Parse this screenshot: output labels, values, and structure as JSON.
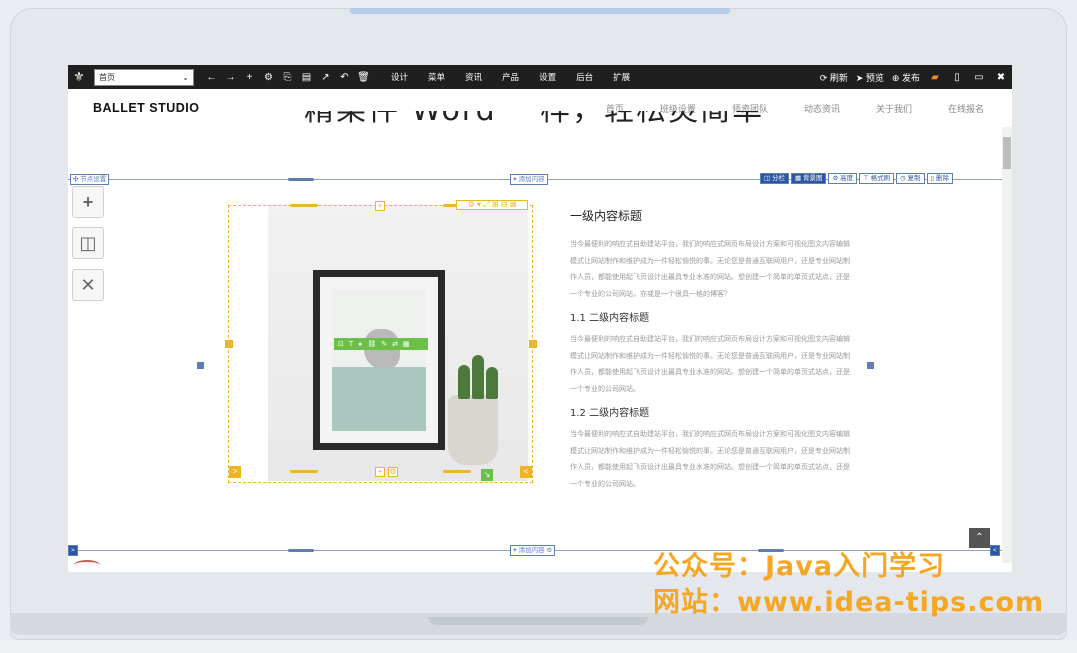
{
  "toolbar": {
    "page_select_value": "首页",
    "menus": [
      "设计",
      "菜单",
      "资讯",
      "产品",
      "设置",
      "后台",
      "扩展"
    ],
    "actions": {
      "refresh": "刷新",
      "preview": "预览",
      "publish": "发布"
    }
  },
  "site": {
    "brand": "BALLET STUDIO",
    "nav": [
      "首页",
      "班级设置",
      "师资团队",
      "动态资讯",
      "关于我们",
      "在线报名"
    ],
    "cut_heading": "精某件 Word 一样，轻松灵简单"
  },
  "guides": {
    "section_settings": "节点设置",
    "add_content_top": "添加内容",
    "add_content_bottom": "添加内容",
    "toolstrip": [
      "分栏",
      "背景图",
      "高度",
      "格式刷",
      "复制",
      "删除"
    ]
  },
  "content": {
    "h1": "一级内容标题",
    "p1": "当今最便利的响应式自助建站平台，我们的响应式网页布局设计方案和可视化图文内容编辑模式让网站制作和维护成为一件轻松愉悦的事。无论您是普通互联网用户，还是专业网站制作人员，都能使用起飞页设计出最具专业水准的网站。想创建一个简单的单页式站点，还是一个专业的公司网站，亦或是一个很具一格的博客？",
    "h2a": "1.1 二级内容标题",
    "p2": "当今最便利的响应式自助建站平台，我们的响应式网页布局设计方案和可视化图文内容编辑模式让网站制作和维护成为一件轻松愉悦的事。无论您是普通互联网用户，还是专业网站制作人员，都能使用起飞页设计出最具专业水准的网站。想创建一个简单的单页式站点，还是一个专业的公司网站。",
    "h2b": "1.2 二级内容标题",
    "p3": "当今最便利的响应式自助建站平台，我们的响应式网页布局设计方案和可视化图文内容编辑模式让网站制作和维护成为一件轻松愉悦的事。无论您是普通互联网用户，还是专业网站制作人员，都能使用起飞页设计出最具专业水准的网站。想创建一个简单的单页式站点，还是一个专业的公司网站。"
  },
  "watermark": {
    "line1": "公众号：Java入门学习",
    "line2": "网站：www.idea-tips.com"
  },
  "colors": {
    "accent_orange": "#f0b429",
    "accent_blue": "#5c7fb6",
    "accent_green": "#6cc04a",
    "watermark": "#f5a623"
  }
}
